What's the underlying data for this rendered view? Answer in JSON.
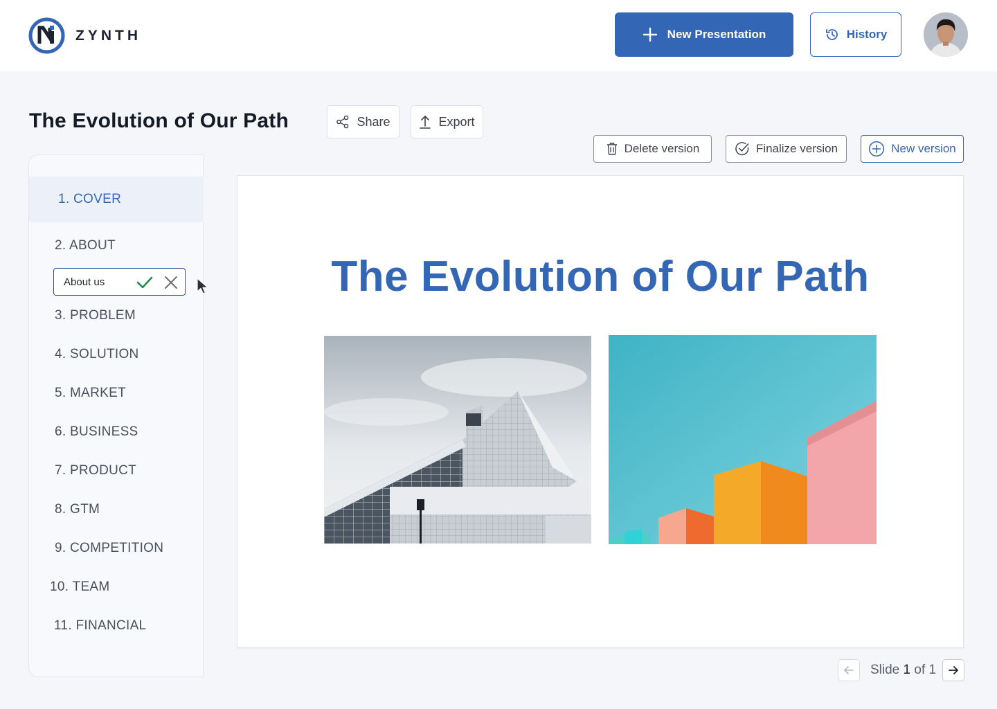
{
  "brand": {
    "name": "ZYNTH",
    "accent": "#3466b6"
  },
  "header": {
    "new_presentation_label": "New Presentation",
    "history_label": "History"
  },
  "page": {
    "title": "The Evolution of Our Path",
    "share_label": "Share",
    "export_label": "Export"
  },
  "versions": {
    "delete_label": "Delete version",
    "finalize_label": "Finalize version",
    "new_label": "New version"
  },
  "sidebar": {
    "items": [
      {
        "label": "1. COVER",
        "active": true
      },
      {
        "label": "2. ABOUT"
      },
      {
        "label": "3. PROBLEM"
      },
      {
        "label": "4. SOLUTION"
      },
      {
        "label": "5. MARKET"
      },
      {
        "label": "6. BUSINESS"
      },
      {
        "label": "7. PRODUCT"
      },
      {
        "label": "8. GTM"
      },
      {
        "label": "9. COMPETITION"
      },
      {
        "label": "10. TEAM"
      },
      {
        "label": "11. FINANCIAL"
      }
    ],
    "rename": {
      "value": "About us"
    }
  },
  "slide": {
    "title": "The Evolution of Our Path",
    "images": [
      "architecture-building-photo",
      "colorful-blocks-photo"
    ]
  },
  "pager": {
    "prefix": "Slide",
    "current": "1",
    "of": "of",
    "total": "1"
  },
  "icons": [
    "plus-icon",
    "history-icon",
    "share-icon",
    "export-icon",
    "trash-icon",
    "check-circle-icon",
    "plus-circle-icon",
    "check-icon",
    "close-icon",
    "arrow-left-icon",
    "arrow-right-icon",
    "cursor-icon"
  ]
}
